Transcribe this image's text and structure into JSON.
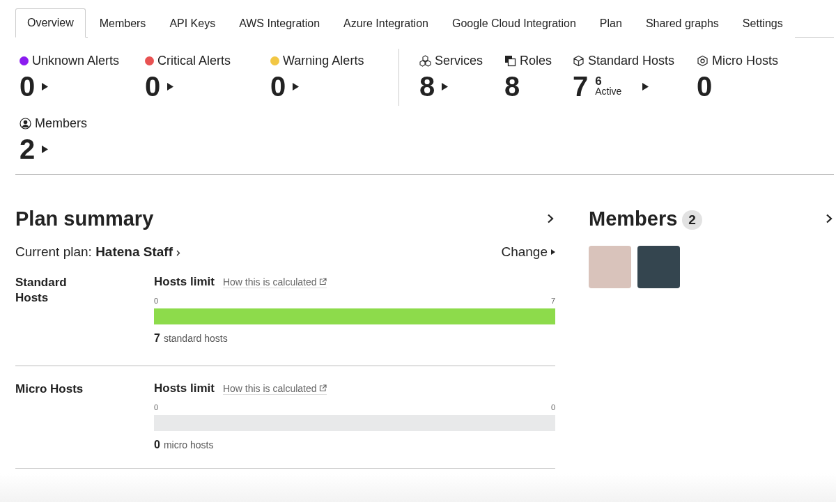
{
  "tabs": [
    {
      "label": "Overview",
      "selected": true
    },
    {
      "label": "Members",
      "selected": false
    },
    {
      "label": "API Keys",
      "selected": false
    },
    {
      "label": "AWS Integration",
      "selected": false
    },
    {
      "label": "Azure Integration",
      "selected": false
    },
    {
      "label": "Google Cloud Integration",
      "selected": false
    },
    {
      "label": "Plan",
      "selected": false
    },
    {
      "label": "Shared graphs",
      "selected": false
    },
    {
      "label": "Settings",
      "selected": false
    }
  ],
  "alert_stats": [
    {
      "label": "Unknown Alerts",
      "value": "0",
      "color": "#8b1cf0",
      "link": true
    },
    {
      "label": "Critical Alerts",
      "value": "0",
      "color": "#e85252",
      "link": true
    },
    {
      "label": "Warning Alerts",
      "value": "0",
      "color": "#f2c744",
      "link": true
    }
  ],
  "resource_stats": [
    {
      "kind": "services",
      "label": "Services",
      "value": "8",
      "link": true
    },
    {
      "kind": "roles",
      "label": "Roles",
      "value": "8",
      "link": false
    },
    {
      "kind": "standard",
      "label": "Standard Hosts",
      "value": "7",
      "sub_value": "6",
      "sub_label": "Active",
      "link": true
    },
    {
      "kind": "micro",
      "label": "Micro Hosts",
      "value": "0",
      "link": false
    }
  ],
  "member_stat": {
    "label": "Members",
    "value": "2",
    "link": true
  },
  "plan_summary": {
    "title": "Plan summary",
    "current_plan_label": "Current plan:",
    "current_plan": "Hatena Staff",
    "change": "Change",
    "limits": [
      {
        "name": "Standard Hosts",
        "heading": "Hosts limit",
        "link": "How this is calculated",
        "min": "0",
        "max": "7",
        "level": 1,
        "count": "7",
        "unit": "standard hosts"
      },
      {
        "name": "Micro Hosts",
        "heading": "Hosts limit",
        "link": "How this is calculated",
        "min": "0",
        "max": "0",
        "level": 0,
        "count": "0",
        "unit": "micro hosts"
      }
    ]
  },
  "members": {
    "title": "Members",
    "count": "2"
  }
}
